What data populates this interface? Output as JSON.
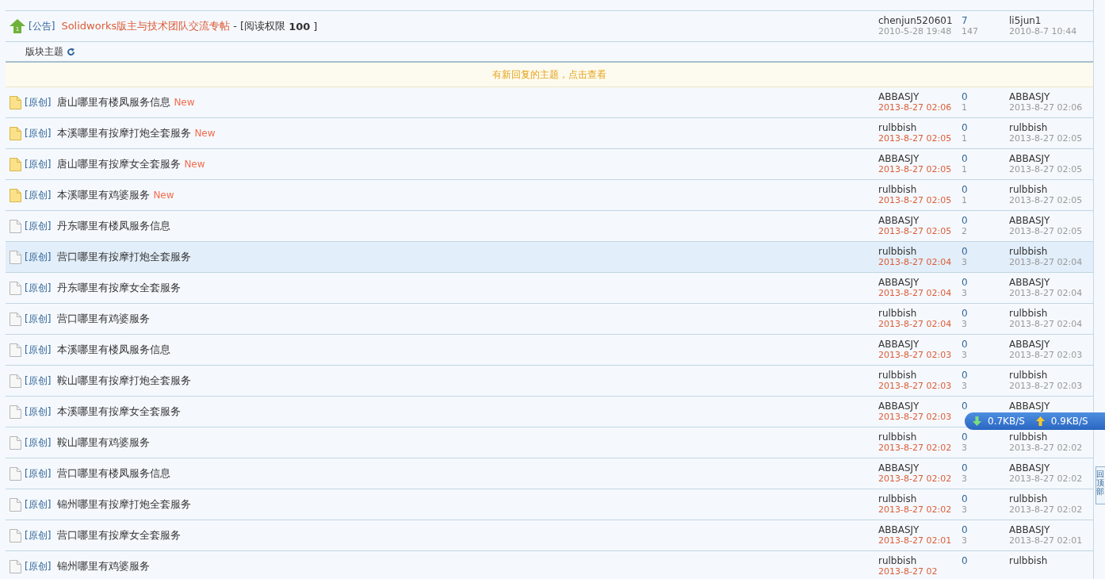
{
  "announcement": {
    "badge": "1",
    "tag": "[公告]",
    "title": "Solidworks版主与技术团队交流专帖",
    "suffix": "- [阅读权限",
    "permission": "100",
    "suffix_end": "]",
    "author": "chenjun520601",
    "author_date": "2010-5-28 19:48",
    "replies": "7",
    "views": "147",
    "last_poster": "li5jun1",
    "last_date": "2010-8-7 10:44"
  },
  "section": {
    "label": "版块主题"
  },
  "notice": "有新回复的主题，点击查看",
  "threads": [
    {
      "kind": "new",
      "highlighted": false,
      "tag": "[原创]",
      "title": "唐山哪里有楼凤服务信息",
      "badge": "New",
      "author": "ABBASJY",
      "date": "2013-8-27 02:06",
      "replies": "0",
      "views": "1",
      "last_poster": "ABBASJY",
      "last_date": "2013-8-27 02:06"
    },
    {
      "kind": "new",
      "highlighted": false,
      "tag": "[原创]",
      "title": "本溪哪里有按摩打炮全套服务",
      "badge": "New",
      "author": "rulbbish",
      "date": "2013-8-27 02:05",
      "replies": "0",
      "views": "1",
      "last_poster": "rulbbish",
      "last_date": "2013-8-27 02:05"
    },
    {
      "kind": "new",
      "highlighted": false,
      "tag": "[原创]",
      "title": "唐山哪里有按摩女全套服务",
      "badge": "New",
      "author": "ABBASJY",
      "date": "2013-8-27 02:05",
      "replies": "0",
      "views": "1",
      "last_poster": "ABBASJY",
      "last_date": "2013-8-27 02:05"
    },
    {
      "kind": "new",
      "highlighted": false,
      "tag": "[原创]",
      "title": "本溪哪里有鸡婆服务",
      "badge": "New",
      "author": "rulbbish",
      "date": "2013-8-27 02:05",
      "replies": "0",
      "views": "1",
      "last_poster": "rulbbish",
      "last_date": "2013-8-27 02:05"
    },
    {
      "kind": "old",
      "highlighted": false,
      "tag": "[原创]",
      "title": "丹东哪里有楼凤服务信息",
      "author": "ABBASJY",
      "date": "2013-8-27 02:05",
      "replies": "0",
      "views": "2",
      "last_poster": "ABBASJY",
      "last_date": "2013-8-27 02:05"
    },
    {
      "kind": "old",
      "highlighted": true,
      "tag": "[原创]",
      "title": "营口哪里有按摩打炮全套服务",
      "author": "rulbbish",
      "date": "2013-8-27 02:04",
      "replies": "0",
      "views": "3",
      "last_poster": "rulbbish",
      "last_date": "2013-8-27 02:04"
    },
    {
      "kind": "old",
      "highlighted": false,
      "tag": "[原创]",
      "title": "丹东哪里有按摩女全套服务",
      "author": "ABBASJY",
      "date": "2013-8-27 02:04",
      "replies": "0",
      "views": "3",
      "last_poster": "ABBASJY",
      "last_date": "2013-8-27 02:04"
    },
    {
      "kind": "old",
      "highlighted": false,
      "tag": "[原创]",
      "title": "营口哪里有鸡婆服务",
      "author": "rulbbish",
      "date": "2013-8-27 02:04",
      "replies": "0",
      "views": "3",
      "last_poster": "rulbbish",
      "last_date": "2013-8-27 02:04"
    },
    {
      "kind": "old",
      "highlighted": false,
      "tag": "[原创]",
      "title": "本溪哪里有楼凤服务信息",
      "author": "ABBASJY",
      "date": "2013-8-27 02:03",
      "replies": "0",
      "views": "3",
      "last_poster": "ABBASJY",
      "last_date": "2013-8-27 02:03"
    },
    {
      "kind": "old",
      "highlighted": false,
      "tag": "[原创]",
      "title": "鞍山哪里有按摩打炮全套服务",
      "author": "rulbbish",
      "date": "2013-8-27 02:03",
      "replies": "0",
      "views": "3",
      "last_poster": "rulbbish",
      "last_date": "2013-8-27 02:03"
    },
    {
      "kind": "old",
      "highlighted": false,
      "tag": "[原创]",
      "title": "本溪哪里有按摩女全套服务",
      "author": "ABBASJY",
      "date": "2013-8-27 02:03",
      "replies": "0",
      "last_poster": "ABBASJY"
    },
    {
      "kind": "old",
      "highlighted": false,
      "tag": "[原创]",
      "title": "鞍山哪里有鸡婆服务",
      "author": "rulbbish",
      "date": "2013-8-27 02:02",
      "replies": "0",
      "views": "3",
      "last_poster": "rulbbish",
      "last_date": "2013-8-27 02:02"
    },
    {
      "kind": "old",
      "highlighted": false,
      "tag": "[原创]",
      "title": "营口哪里有楼凤服务信息",
      "author": "ABBASJY",
      "date": "2013-8-27 02:02",
      "replies": "0",
      "views": "3",
      "last_poster": "ABBASJY",
      "last_date": "2013-8-27 02:02"
    },
    {
      "kind": "old",
      "highlighted": false,
      "tag": "[原创]",
      "title": "锦州哪里有按摩打炮全套服务",
      "author": "rulbbish",
      "date": "2013-8-27 02:02",
      "replies": "0",
      "views": "3",
      "last_poster": "rulbbish",
      "last_date": "2013-8-27 02:02"
    },
    {
      "kind": "old",
      "highlighted": false,
      "tag": "[原创]",
      "title": "营口哪里有按摩女全套服务",
      "author": "ABBASJY",
      "date": "2013-8-27 02:01",
      "replies": "0",
      "views": "3",
      "last_poster": "ABBASJY",
      "last_date": "2013-8-27 02:01"
    },
    {
      "kind": "old",
      "highlighted": false,
      "tag": "[原创]",
      "title": "锦州哪里有鸡婆服务",
      "author": "rulbbish",
      "date": "2013-8-27 02",
      "replies": "0",
      "last_poster": "rulbbish"
    }
  ],
  "speed_widget": {
    "download": "0.7KB/S",
    "upload": "0.9KB/S"
  },
  "back_to_top": "回顶部"
}
